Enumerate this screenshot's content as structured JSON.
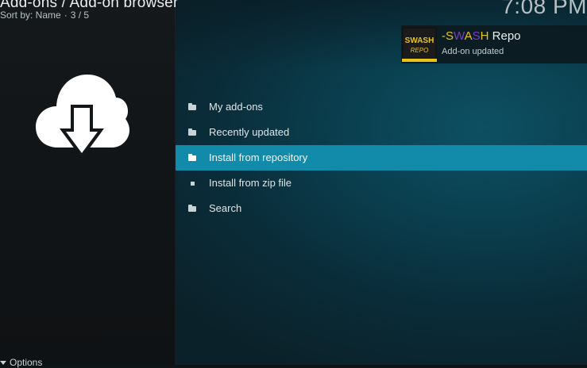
{
  "header": {
    "title": "Add-ons / Add-on browser",
    "sort_label": "Sort by: Name",
    "separator": "·",
    "position": "3 / 5"
  },
  "clock": {
    "time": "7:08 PM"
  },
  "hero": {
    "icon": "cloud-download-icon"
  },
  "notification": {
    "title_parts": [
      "-",
      "S",
      "W",
      "A",
      "S",
      "H"
    ],
    "title_suffix": " Repo",
    "subtitle": "Add-on updated",
    "thumb_text_top": "SWASH",
    "thumb_text_bottom": "REPO",
    "colors": {
      "yellow": "#e8c31c",
      "purple": "#7a3fc2"
    }
  },
  "menu": {
    "items": [
      {
        "label": "My add-ons",
        "icon": "folder-icon"
      },
      {
        "label": "Recently updated",
        "icon": "folder-icon"
      },
      {
        "label": "Install from repository",
        "icon": "folder-icon",
        "selected": true
      },
      {
        "label": "Install from zip file",
        "icon": "zip-file-icon"
      },
      {
        "label": "Search",
        "icon": "folder-icon"
      }
    ]
  },
  "footer": {
    "options_label": "Options"
  },
  "colors": {
    "accent": "#128aa9",
    "left_panel": "#13171a",
    "right_panel": "#0a3f4f"
  }
}
